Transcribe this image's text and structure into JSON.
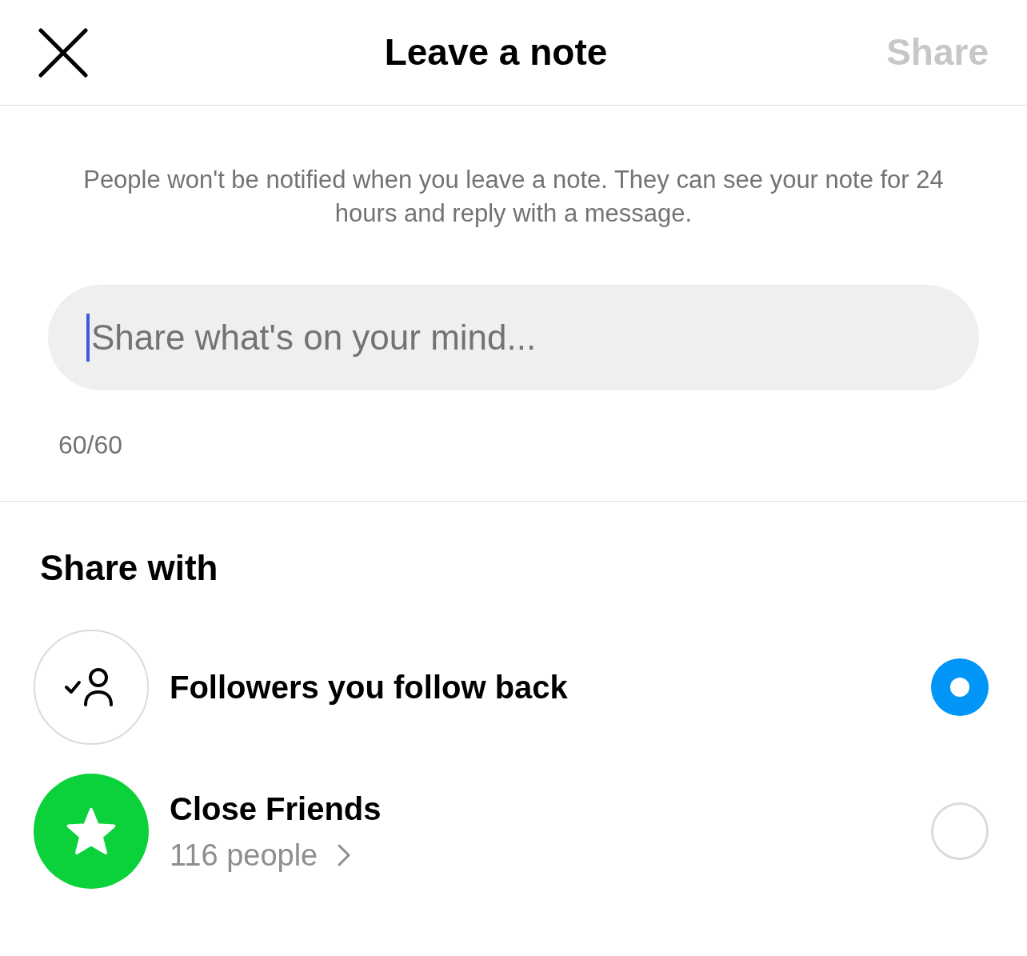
{
  "header": {
    "title": "Leave a note",
    "share_button": {
      "label": "Share",
      "disabled": true
    }
  },
  "notice": "People won't be notified when you leave a note. They can see your note for 24 hours and reply with a message.",
  "note_field": {
    "placeholder": "Share what's on your mind...",
    "counter": "60/60"
  },
  "share_with": {
    "heading": "Share with",
    "options": [
      {
        "kind": "follow-back",
        "label": "Followers you follow back",
        "selected": true
      },
      {
        "kind": "close-friends",
        "label": "Close Friends",
        "subtitle": "116 people",
        "selected": false
      }
    ]
  }
}
